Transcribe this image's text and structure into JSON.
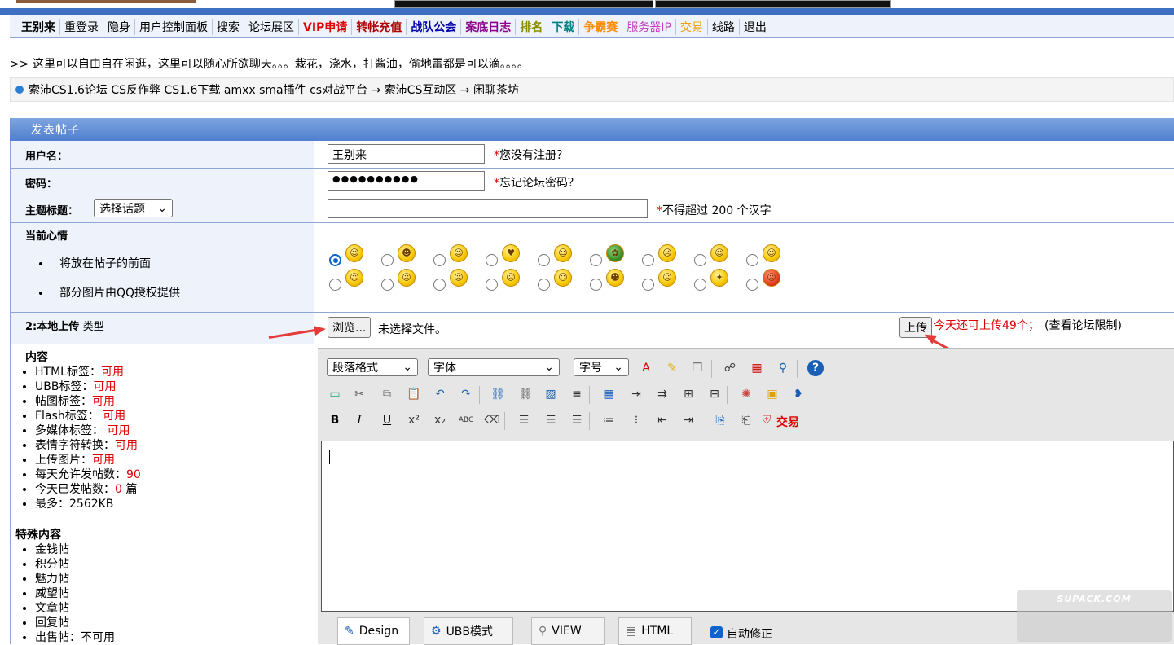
{
  "nav": {
    "items": [
      {
        "label": "王别来",
        "color": "#000",
        "bold": true
      },
      {
        "label": "重登录",
        "color": "#000",
        "bold": false
      },
      {
        "label": "隐身",
        "color": "#000",
        "bold": false
      },
      {
        "label": "用户控制面板",
        "color": "#000",
        "bold": false
      },
      {
        "label": "搜索",
        "color": "#000",
        "bold": false
      },
      {
        "label": "论坛展区",
        "color": "#000",
        "bold": false
      },
      {
        "label": "VIP申请",
        "color": "#e00000",
        "bold": true
      },
      {
        "label": "转帐充值",
        "color": "#b00000",
        "bold": true
      },
      {
        "label": "战队公会",
        "color": "#0000aa",
        "bold": true
      },
      {
        "label": "案底日志",
        "color": "#8b008b",
        "bold": true
      },
      {
        "label": "排名",
        "color": "#8b8b00",
        "bold": true
      },
      {
        "label": "下载",
        "color": "#008080",
        "bold": true
      },
      {
        "label": "争霸赛",
        "color": "#ff8c00",
        "bold": true
      },
      {
        "label": "服务器IP",
        "color": "#c040c0",
        "bold": false
      },
      {
        "label": "交易",
        "color": "#f0a000",
        "bold": false
      },
      {
        "label": "线路",
        "color": "#000",
        "bold": false
      },
      {
        "label": "退出",
        "color": "#000",
        "bold": false
      }
    ]
  },
  "intro": ">> 这里可以自由自在闲逛，这里可以随心所欲聊天。。。栽花，浇水，打酱油，偷地雷都是可以滴。。。。",
  "breadcrumb": "索沛CS1.6论坛 CS反作弊 CS1.6下载 amxx sma插件 cs对战平台 → 索沛CS互动区 → 闲聊茶坊",
  "form": {
    "title": "发表帖子",
    "username_label": "用户名：",
    "username_value": "王别来",
    "username_hint": "您没有注册？",
    "password_label": "密码：",
    "password_value": "●●●●●●●●●●",
    "password_hint": "忘记论坛密码？",
    "subject_label": "主题标题：",
    "topic_select": "选择话题",
    "subject_hint": "不得超过 200 个汉字",
    "required_mark": "*",
    "mood_label": "当前心情",
    "mood_notes": [
      "将放在帖子的前面",
      "部分图片由QQ授权提供"
    ],
    "upload_label": "2:本地上传",
    "upload_type": "类型",
    "browse_button": "浏览...",
    "no_file": "未选择文件。",
    "upload_button": "上传",
    "upload_remaining": "今天还可上传49个；",
    "upload_limit_link": "(查看论坛限制)"
  },
  "info": {
    "content_title": "内容",
    "items": [
      {
        "label": "HTML标签：",
        "value": "可用"
      },
      {
        "label": "UBB标签：",
        "value": "可用"
      },
      {
        "label": "帖图标签：",
        "value": "可用"
      },
      {
        "label": "Flash标签：",
        "value": " 可用"
      },
      {
        "label": "多媒体标签：",
        "value": " 可用"
      },
      {
        "label": "表情字符转换：",
        "value": "可用"
      },
      {
        "label": "上传图片：",
        "value": "可用"
      },
      {
        "label": "每天允许发帖数：",
        "value": "90"
      },
      {
        "label": "今天已发帖数：",
        "value": "0",
        "suffix": " 篇"
      },
      {
        "label": "最多：2562KB",
        "value": ""
      }
    ],
    "special_title": "特殊内容",
    "special_items": [
      "金钱帖",
      "积分帖",
      "魅力帖",
      "威望帖",
      "文章帖",
      "回复帖",
      "出售帖：不可用"
    ]
  },
  "editor": {
    "paragraph_select": "段落格式",
    "font_select": "字体",
    "size_select": "字号",
    "trade_label": "交易",
    "tabs": [
      "Design",
      "UBB模式",
      "VIEW",
      "HTML"
    ],
    "autofix_label": "自动修正"
  },
  "watermark": "SUPACK.COM"
}
